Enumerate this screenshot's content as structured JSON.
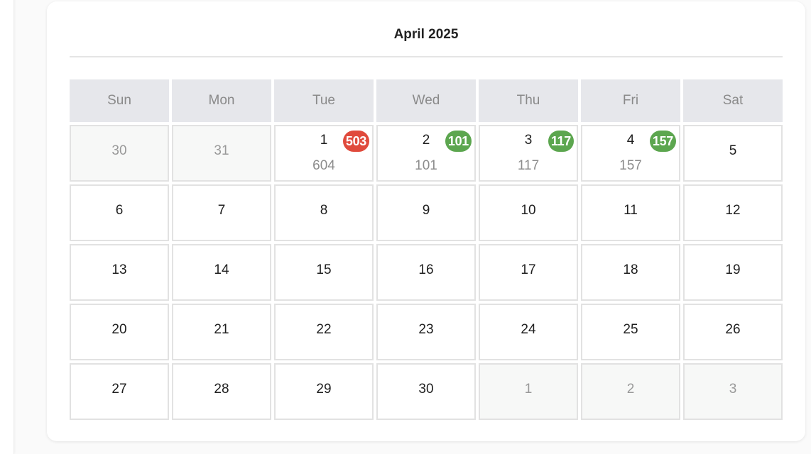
{
  "calendar": {
    "title": "April 2025",
    "weekdays": [
      "Sun",
      "Mon",
      "Tue",
      "Wed",
      "Thu",
      "Fri",
      "Sat"
    ],
    "colors": {
      "header_bg": "#e6e7eb",
      "other_month_bg": "#f7f8f7",
      "badge_high": "#e04a3c",
      "badge_normal": "#5ca64f"
    },
    "weeks": [
      [
        {
          "day": "30",
          "other": true
        },
        {
          "day": "31",
          "other": true
        },
        {
          "day": "1",
          "badge": "503",
          "badge_color": "red",
          "total": "604"
        },
        {
          "day": "2",
          "badge": "101",
          "badge_color": "green",
          "total": "101"
        },
        {
          "day": "3",
          "badge": "117",
          "badge_color": "green",
          "total": "117"
        },
        {
          "day": "4",
          "badge": "157",
          "badge_color": "green",
          "total": "157"
        },
        {
          "day": "5"
        }
      ],
      [
        {
          "day": "6"
        },
        {
          "day": "7"
        },
        {
          "day": "8"
        },
        {
          "day": "9"
        },
        {
          "day": "10"
        },
        {
          "day": "11"
        },
        {
          "day": "12"
        }
      ],
      [
        {
          "day": "13"
        },
        {
          "day": "14"
        },
        {
          "day": "15"
        },
        {
          "day": "16"
        },
        {
          "day": "17"
        },
        {
          "day": "18"
        },
        {
          "day": "19"
        }
      ],
      [
        {
          "day": "20"
        },
        {
          "day": "21"
        },
        {
          "day": "22"
        },
        {
          "day": "23"
        },
        {
          "day": "24"
        },
        {
          "day": "25"
        },
        {
          "day": "26"
        }
      ],
      [
        {
          "day": "27"
        },
        {
          "day": "28"
        },
        {
          "day": "29"
        },
        {
          "day": "30"
        },
        {
          "day": "1",
          "other": true
        },
        {
          "day": "2",
          "other": true
        },
        {
          "day": "3",
          "other": true
        }
      ]
    ]
  }
}
